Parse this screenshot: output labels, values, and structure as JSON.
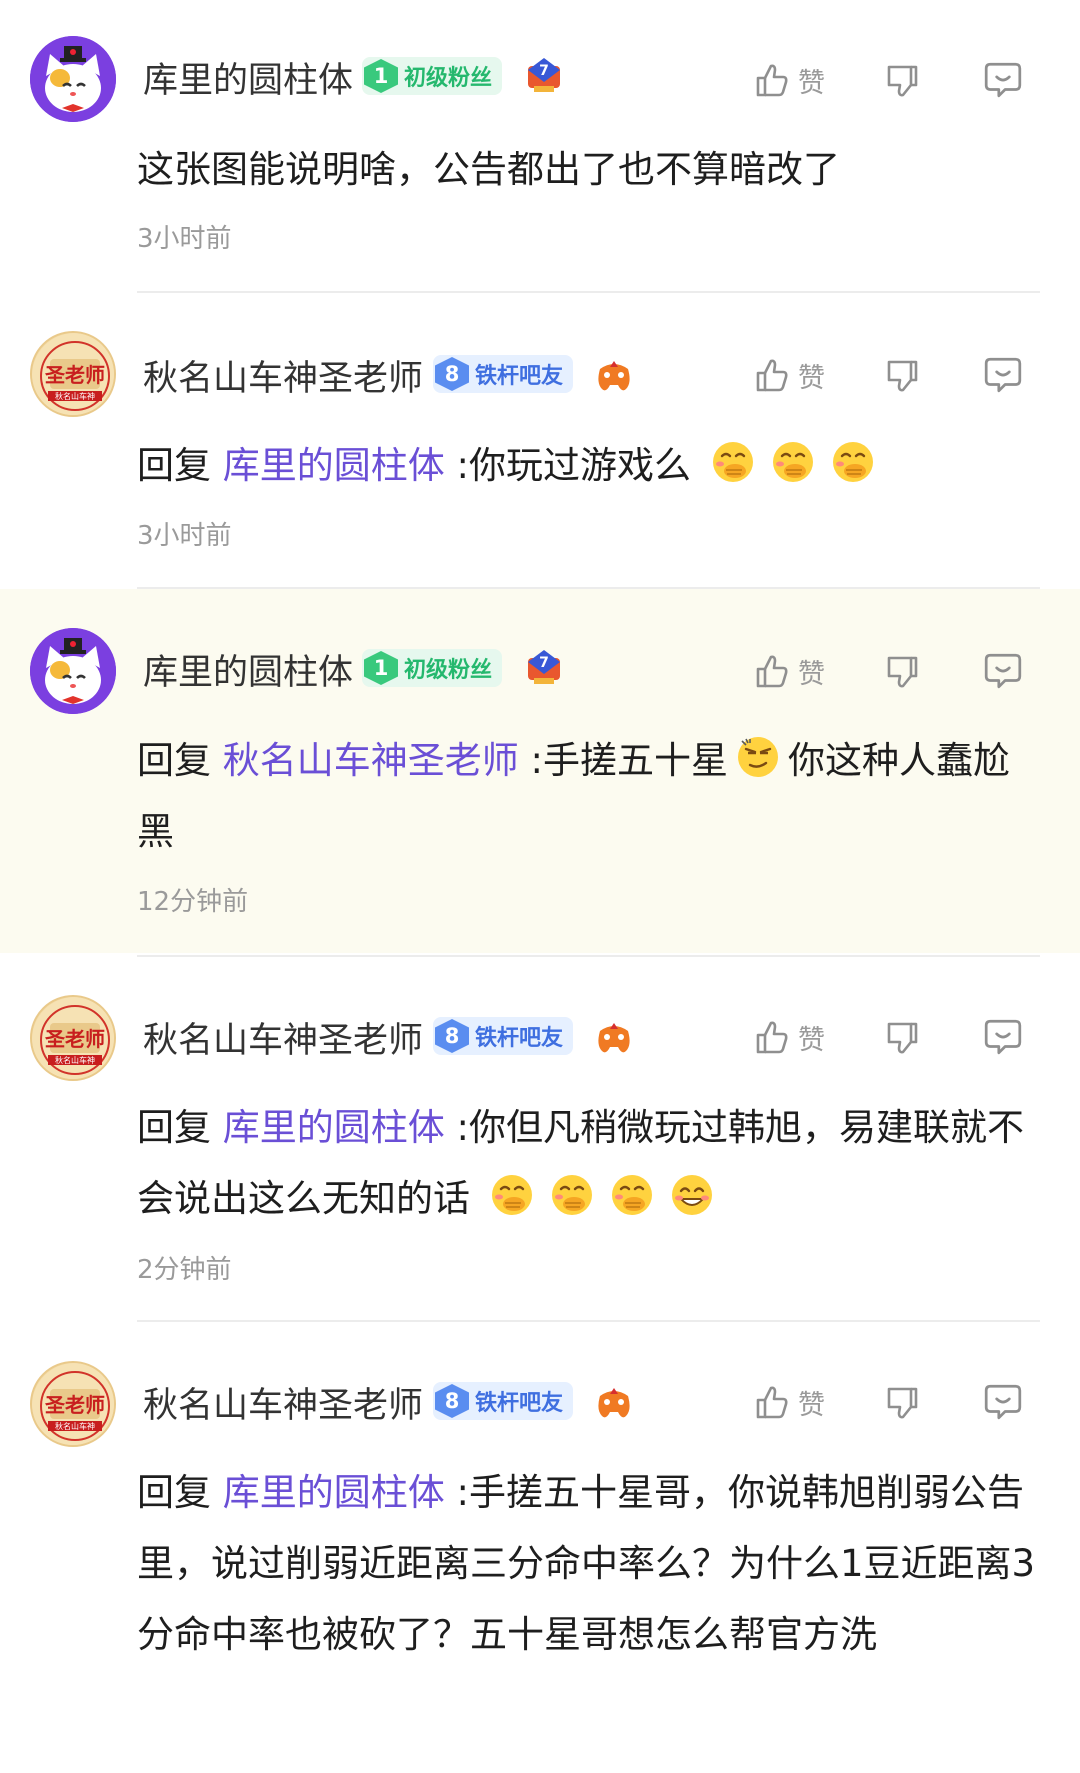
{
  "labels": {
    "like": "赞"
  },
  "comments": [
    {
      "user": "库里的圆柱体",
      "level_num": "1",
      "level_label": "初级粉丝",
      "prefix": "",
      "mention": "",
      "text": "这张图能说明啥，公告都出了也不算暗改了",
      "time": "3小时前"
    },
    {
      "user": "秋名山车神圣老师",
      "level_num": "8",
      "level_label": "铁杆吧友",
      "prefix": "回复",
      "mention": "库里的圆柱体",
      "text": " :你玩过游戏么",
      "time": "3小时前"
    },
    {
      "user": "库里的圆柱体",
      "level_num": "1",
      "level_label": "初级粉丝",
      "prefix": "回复",
      "mention": "秋名山车神圣老师",
      "text_a": " :手搓五十星",
      "text_b": "你这种人蠢尬黑",
      "time": "12分钟前"
    },
    {
      "user": "秋名山车神圣老师",
      "level_num": "8",
      "level_label": "铁杆吧友",
      "prefix": "回复",
      "mention": "库里的圆柱体",
      "text": " :你但凡稍微玩过韩旭，易建联就不会说出这么无知的话",
      "time": "2分钟前"
    },
    {
      "user": "秋名山车神圣老师",
      "level_num": "8",
      "level_label": "铁杆吧友",
      "prefix": "回复",
      "mention": "库里的圆柱体",
      "text": " :手搓五十星哥，你说韩旭削弱公告里，说过削弱近距离三分命中率么？为什么1豆近距离3分命中率也被砍了？五十星哥想怎么帮官方洗",
      "time": ""
    }
  ],
  "colors": {
    "mention": "#6a4fd6",
    "highlight_bg": "#fcfbf0",
    "level_green": "#39c97d",
    "level_blue": "#5a8df0",
    "secondary_text": "#9a9a9a"
  },
  "icons": [
    "cat-avatar",
    "seal-avatar",
    "level-7-badge-icon",
    "game-controller-icon",
    "thumbs-up-icon",
    "thumbs-down-icon",
    "reply-bubble-icon",
    "cover-mouth-laugh-emoji",
    "smug-emoji",
    "grin-emoji"
  ]
}
